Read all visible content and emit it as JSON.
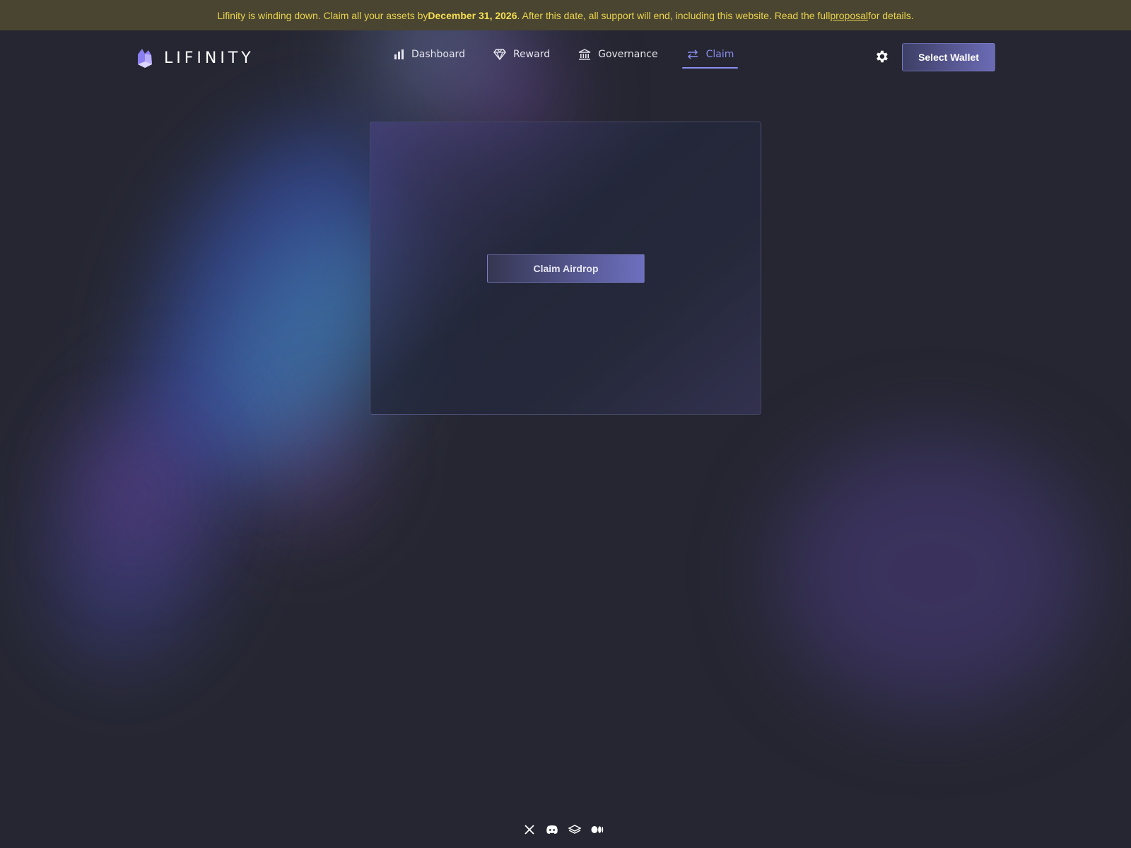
{
  "banner": {
    "text_before": "Lifinity is winding down. Claim all your assets by ",
    "date": "December 31, 2026",
    "text_middle": ". After this date, all support will end, including this website. Read the full ",
    "link": "proposal",
    "text_after": " for details."
  },
  "header": {
    "logo_text": "LIFINITY",
    "nav": [
      {
        "label": "Dashboard",
        "icon": "bar-chart-icon"
      },
      {
        "label": "Reward",
        "icon": "diamond-icon"
      },
      {
        "label": "Governance",
        "icon": "bank-icon"
      },
      {
        "label": "Claim",
        "icon": "swap-arrows-icon",
        "active": true
      }
    ],
    "wallet_label": "Select Wallet"
  },
  "claim_card": {
    "button_label": "Claim Airdrop"
  },
  "footer": {
    "icons": [
      "x-twitter-icon",
      "discord-icon",
      "gitbook-icon",
      "medium-icon"
    ]
  },
  "colors": {
    "banner_bg": "#4a4530",
    "banner_text": "#e9d34f",
    "accent": "#8b8ef0",
    "page_bg": "#252631"
  }
}
